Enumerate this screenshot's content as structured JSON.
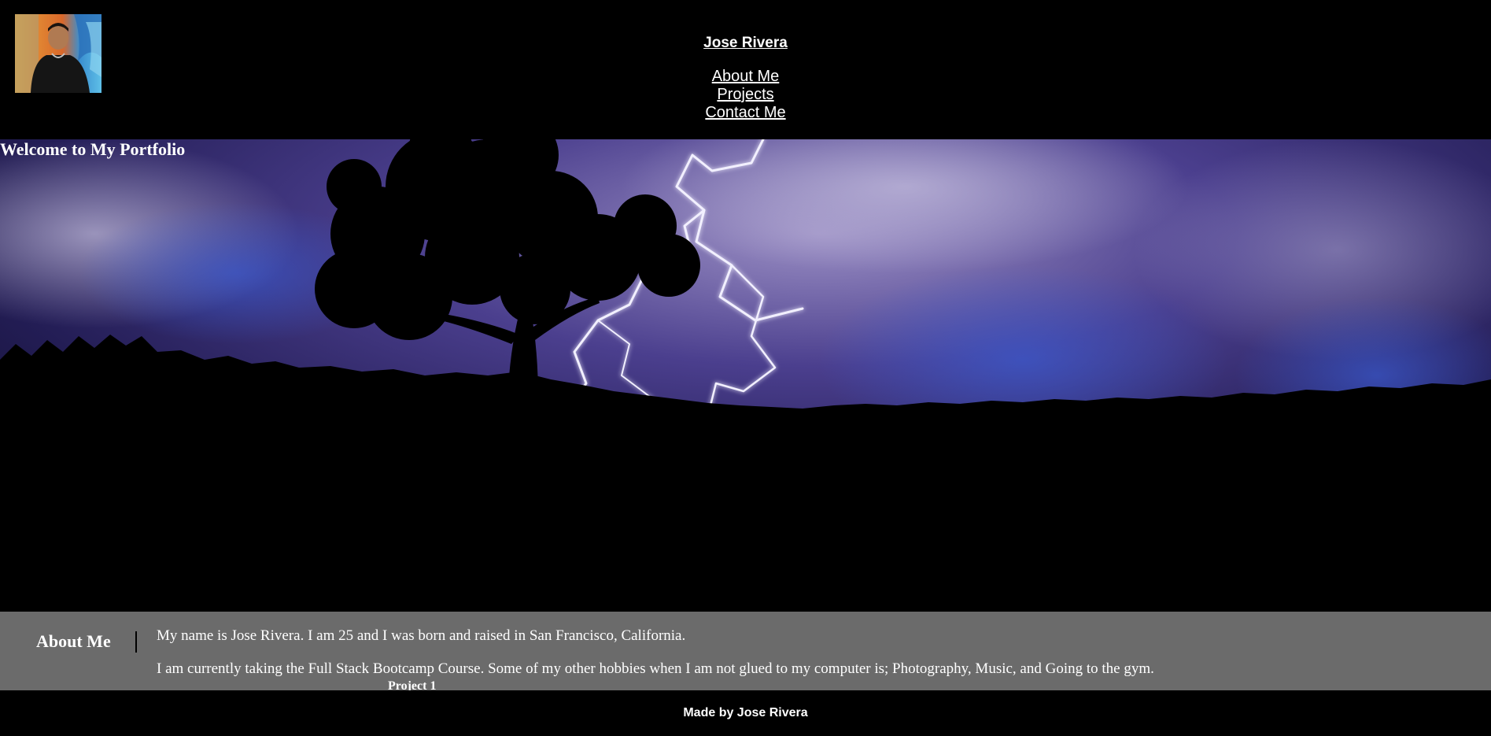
{
  "header": {
    "title": "Jose Rivera",
    "nav": [
      "About Me",
      "Projects",
      "Contact Me"
    ]
  },
  "hero": {
    "heading": "Welcome to My Portfolio"
  },
  "about": {
    "heading": "About Me",
    "paragraphs": [
      "My name is Jose Rivera. I am 25 and I was born and raised in San Francisco, California.",
      "I am currently taking the Full Stack Bootcamp Course. Some of my other hobbies when I am not glued to my computer is; Photography, Music, and Going to the gym."
    ]
  },
  "projects": {
    "first_label": "Project 1"
  },
  "footer": {
    "text": "Made by Jose Rivera"
  },
  "colors": {
    "background": "#000000",
    "about_band": "#6b6b6b",
    "text": "#ffffff"
  }
}
